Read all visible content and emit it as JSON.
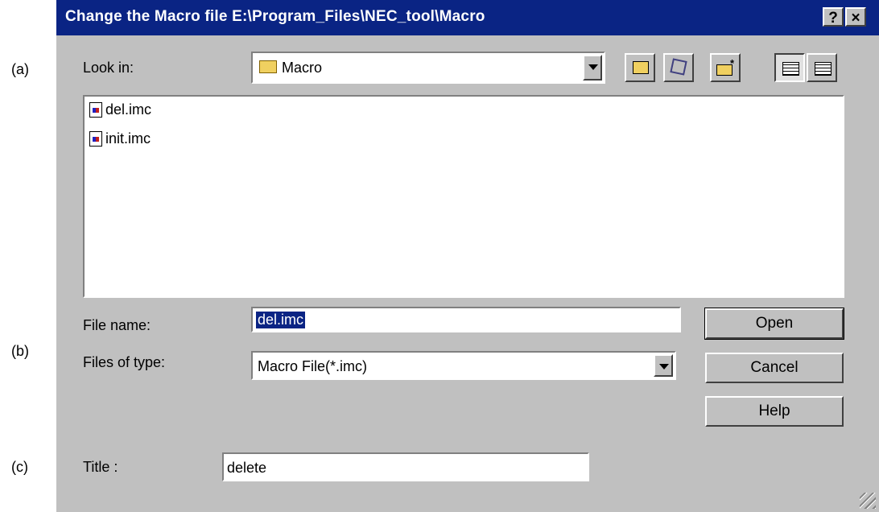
{
  "callouts": {
    "a": "(a)",
    "b": "(b)",
    "c": "(c)"
  },
  "dialog": {
    "title": "Change the Macro file E:\\Program_Files\\NEC_tool\\Macro",
    "help_btn": "?",
    "close_btn": "×"
  },
  "look_in": {
    "label": "Look in:",
    "value": "Macro"
  },
  "files": [
    {
      "name": "del.imc"
    },
    {
      "name": "init.imc"
    }
  ],
  "file_name": {
    "label": "File name:",
    "value": "del.imc"
  },
  "files_of_type": {
    "label": "Files of type:",
    "value": "Macro File(*.imc)"
  },
  "buttons": {
    "open": "Open",
    "cancel": "Cancel",
    "help": "Help"
  },
  "title_field": {
    "label": "Title :",
    "value": "delete"
  },
  "icons": [
    "up-one-level-icon",
    "desktop-icon",
    "new-folder-icon",
    "list-view-icon",
    "details-view-icon"
  ]
}
